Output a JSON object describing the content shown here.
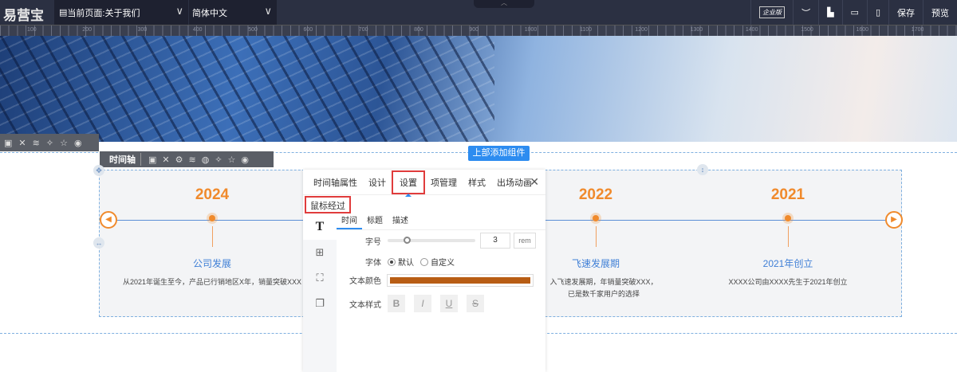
{
  "topbar": {
    "logo": "易营宝",
    "page_select": "当前页面:关于我们",
    "lang_select": "简体中文",
    "edition_badge": "企业版",
    "save": "保存",
    "preview": "预览"
  },
  "ruler": [
    "100",
    "200",
    "300",
    "400",
    "500",
    "600",
    "700",
    "800",
    "900",
    "1000",
    "1100",
    "1200",
    "1300",
    "1400",
    "1500",
    "1600",
    "1700"
  ],
  "section_toolbar": {
    "label": "时间轴"
  },
  "add_component": "上部添加组件",
  "timeline": {
    "items": [
      {
        "year": "2024",
        "title": "公司发展",
        "desc": "从2021年诞生至今，产品已行销地区X年，销量突破XXX"
      },
      {
        "year": "2022",
        "title": "飞速发展期",
        "desc": "入飞速发展期，年销量突破XXX，已是数千家用户的选择"
      },
      {
        "year": "2021",
        "title": "2021年创立",
        "desc": "XXXX公司由XXXX先生于2021年创立"
      }
    ]
  },
  "panel": {
    "tabs": [
      "时间轴属性",
      "设计",
      "设置",
      "项管理",
      "样式",
      "出场动画"
    ],
    "active_tab": "设置",
    "state": "鼠标经过",
    "subtabs": [
      "时间",
      "标题",
      "描述"
    ],
    "font_size_label": "字号",
    "font_size": "3",
    "font_unit": "rem",
    "font_label": "字体",
    "font_default": "默认",
    "font_custom": "自定义",
    "color_label": "文本颜色",
    "color": "#b85d14",
    "style_label": "文本样式",
    "styles": [
      "B",
      "I",
      "U",
      "S"
    ]
  }
}
